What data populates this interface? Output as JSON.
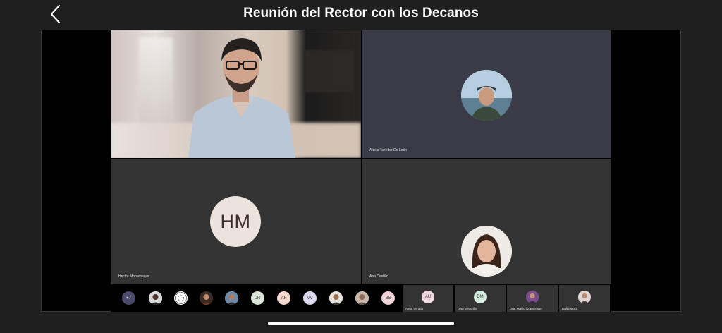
{
  "header": {
    "title": "Reunión del Rector con los Decanos",
    "back_icon": "chevron-left-icon"
  },
  "tiles": {
    "video": {
      "kind": "camera"
    },
    "alexis": {
      "name": "Alexis Tapedor De León"
    },
    "hector": {
      "name": "Hector Montemayor",
      "initials": "HM"
    },
    "ana": {
      "name": "Ana Castillo"
    }
  },
  "strip": {
    "overflow_count": "+7",
    "avatars": [
      {
        "type": "photo"
      },
      {
        "type": "logo"
      },
      {
        "type": "photo"
      },
      {
        "type": "photo"
      },
      {
        "type": "initials",
        "text": "JR",
        "color": "#dbe7d6"
      },
      {
        "type": "initials",
        "text": "AF",
        "color": "#f6d8d0"
      },
      {
        "type": "initials",
        "text": "VV",
        "color": "#dcd9f1"
      },
      {
        "type": "photo"
      },
      {
        "type": "photo"
      },
      {
        "type": "initials",
        "text": "BS",
        "color": "#f4d4dc"
      }
    ],
    "named": [
      {
        "initials": "AU",
        "name": "Alma Urrutia",
        "color": "#f2d6df"
      },
      {
        "initials": "DM",
        "name": "Danny Murillo",
        "color": "#d3ece0"
      },
      {
        "initials": "",
        "name": "Dra. Mayitzi Zambrano",
        "color": "#8a5f9e"
      },
      {
        "initials": "",
        "name": "Dafni Mora",
        "color": "#cdbfb8"
      }
    ]
  },
  "colors": {
    "background": "#1f1f1f",
    "tile_dark": "#333333",
    "tile_blue": "#3b3b47",
    "hm_avatar": "#ece3dc"
  }
}
